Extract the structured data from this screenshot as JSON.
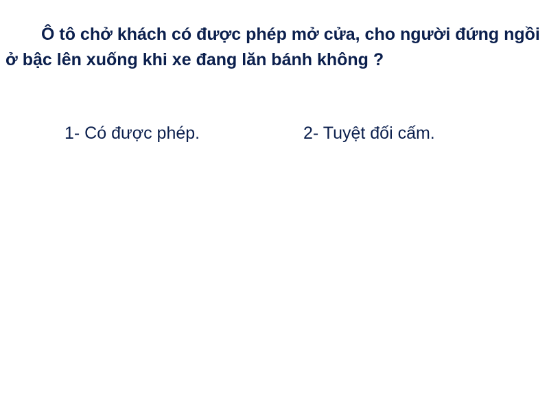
{
  "question": {
    "text": "Ô tô chở khách có được phép mở cửa, cho người đứng ngồi ở bậc lên xuống khi xe đang lăn bánh không ?"
  },
  "answers": [
    {
      "label": "1- Có được phép."
    },
    {
      "label": "2- Tuyệt đối cấm."
    }
  ],
  "colors": {
    "text": "#0b1f4d",
    "background": "#ffffff"
  }
}
